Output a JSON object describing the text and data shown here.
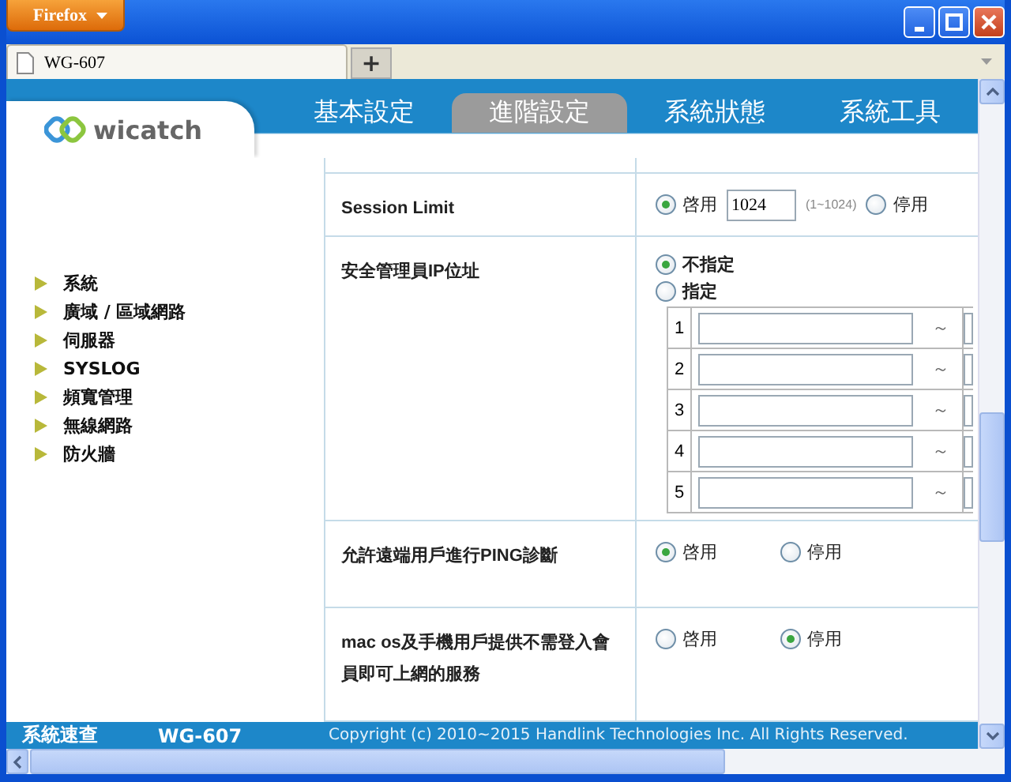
{
  "browser": {
    "menu_button": "Firefox",
    "tab_title": "WG-607",
    "new_tab": "+"
  },
  "logo": "wicatch",
  "nav_tabs": [
    {
      "label": "基本設定",
      "selected": false
    },
    {
      "label": "進階設定",
      "selected": true
    },
    {
      "label": "系統狀態",
      "selected": false
    },
    {
      "label": "系統工具",
      "selected": false
    }
  ],
  "sidebar": {
    "items": [
      "系統",
      "廣域 / 區域網路",
      "伺服器",
      "SYSLOG",
      "頻寬管理",
      "無線網路",
      "防火牆"
    ]
  },
  "settings": [
    {
      "kind": "limit",
      "label": "Session Limit",
      "value": "1024",
      "hint": "(1~1024)",
      "options": [
        {
          "label": "啓用",
          "selected": true
        },
        {
          "label": "停用",
          "selected": false
        }
      ]
    },
    {
      "kind": "ip_ranges",
      "label": "安全管理員IP位址",
      "options": [
        {
          "label": "不指定",
          "selected": true
        },
        {
          "label": "指定",
          "selected": false
        }
      ],
      "ranges": [
        {
          "number": "1",
          "separator": "～"
        },
        {
          "number": "2",
          "separator": "～"
        },
        {
          "number": "3",
          "separator": "～"
        },
        {
          "number": "4",
          "separator": "～"
        },
        {
          "number": "5",
          "separator": "～"
        }
      ]
    },
    {
      "kind": "radio",
      "label": "允許遠端用戶進行PING診斷",
      "options": [
        {
          "label": "啓用",
          "selected": true
        },
        {
          "label": "停用",
          "selected": false
        }
      ]
    },
    {
      "kind": "radio",
      "label": "mac os及手機用戶提供不需登入會員即可上網的服務",
      "options": [
        {
          "label": "啓用",
          "selected": false
        },
        {
          "label": "停用",
          "selected": true
        }
      ]
    }
  ],
  "footer": {
    "title": "系統速查",
    "model": "WG-607",
    "copyright": "Copyright (c) 2010~2015 Handlink Technologies Inc. All Rights Reserved."
  }
}
